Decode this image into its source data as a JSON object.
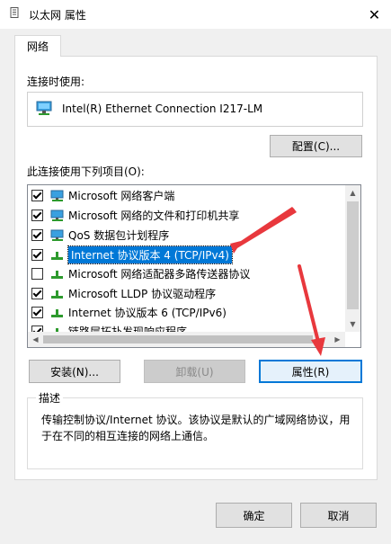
{
  "window": {
    "title": "以太网 属性",
    "close_glyph": "✕"
  },
  "tabs": [
    {
      "label": "网络"
    }
  ],
  "connect_using": {
    "label": "连接时使用:",
    "adapter": "Intel(R) Ethernet Connection I217-LM"
  },
  "buttons": {
    "configure": "配置(C)...",
    "install": "安装(N)...",
    "uninstall": "卸载(U)",
    "properties": "属性(R)",
    "ok": "确定",
    "cancel": "取消"
  },
  "items_label": "此连接使用下列项目(O):",
  "items": [
    {
      "label": "Microsoft 网络客户端",
      "checked": true,
      "icon": "network-client-icon"
    },
    {
      "label": "Microsoft 网络的文件和打印机共享",
      "checked": true,
      "icon": "network-share-icon"
    },
    {
      "label": "QoS 数据包计划程序",
      "checked": true,
      "icon": "network-service-icon"
    },
    {
      "label": "Internet 协议版本 4 (TCP/IPv4)",
      "checked": true,
      "icon": "protocol-icon",
      "selected": true
    },
    {
      "label": "Microsoft 网络适配器多路传送器协议",
      "checked": false,
      "icon": "protocol-icon"
    },
    {
      "label": "Microsoft LLDP 协议驱动程序",
      "checked": true,
      "icon": "protocol-icon"
    },
    {
      "label": "Internet 协议版本 6 (TCP/IPv6)",
      "checked": true,
      "icon": "protocol-icon"
    },
    {
      "label": "链路层拓扑发现响应程序",
      "checked": true,
      "icon": "protocol-icon"
    }
  ],
  "description": {
    "title": "描述",
    "text": "传输控制协议/Internet 协议。该协议是默认的广域网络协议，用于在不同的相互连接的网络上通信。"
  },
  "colors": {
    "accent": "#0078d7",
    "annotation_arrow": "#e8383d"
  }
}
